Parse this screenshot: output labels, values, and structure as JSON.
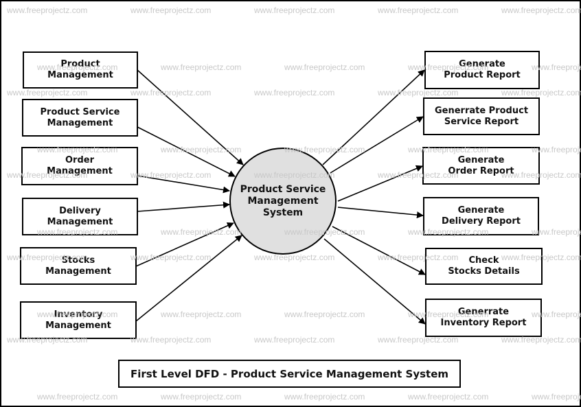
{
  "diagram": {
    "title": "First Level DFD - Product Service Management System",
    "central_process": "Product Service\nManagement\nSystem",
    "inputs": [
      "Product\nManagement",
      "Product Service\nManagement",
      "Order\nManagement",
      "Delivery\nManagement",
      "Stocks\nManagement",
      "Inventory\nManagement"
    ],
    "outputs": [
      "Generate\nProduct Report",
      "Generrate Product\nService Report",
      "Generate\nOrder Report",
      "Generate\nDelivery Report",
      "Check\nStocks Details",
      "Generrate\nInventory Report"
    ],
    "watermark": "www.freeprojectz.com",
    "colors": {
      "process_fill": "#e0e0e0",
      "stroke": "#000000",
      "watermark": "#c8c8c8"
    }
  }
}
